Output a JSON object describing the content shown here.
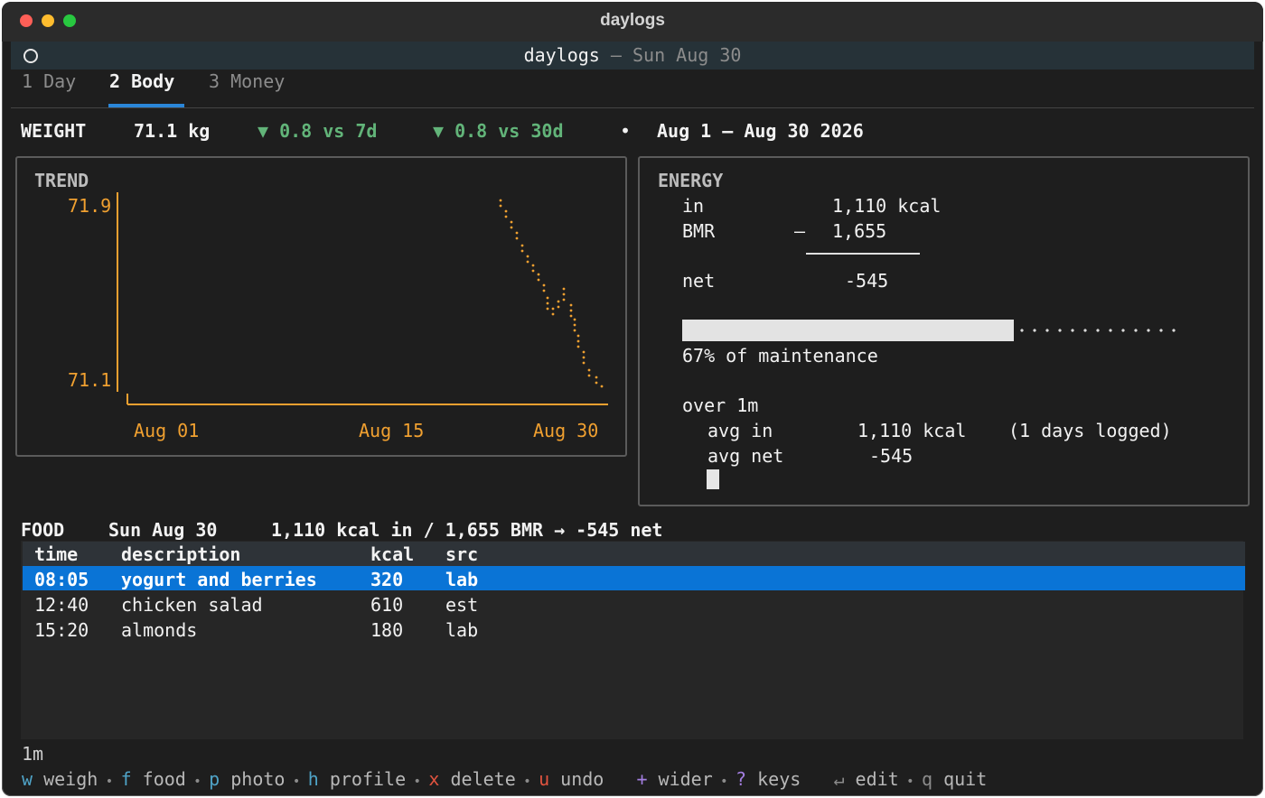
{
  "window": {
    "title": "daylogs"
  },
  "header": {
    "app": "daylogs",
    "sep": "—",
    "date": "Sun Aug 30"
  },
  "tabs": [
    {
      "num": "1",
      "label": "Day"
    },
    {
      "num": "2",
      "label": "Body"
    },
    {
      "num": "3",
      "label": "Money"
    }
  ],
  "weight_line": {
    "label": "WEIGHT",
    "value": "71.1 kg",
    "delta7": "▼ 0.8 vs 7d",
    "delta30": "▼ 0.8 vs 30d",
    "bullet": "•",
    "range": "Aug 1 — Aug 30 2026"
  },
  "trend": {
    "title": "TREND",
    "ymax_label": "71.9",
    "ymin_label": "71.1",
    "x_labels": [
      "Aug 01",
      "Aug 15",
      "Aug 30"
    ]
  },
  "energy": {
    "title": "ENERGY",
    "in_label": "in",
    "in_value": "1,110 kcal",
    "bmr_label": "BMR",
    "bmr_op": "–",
    "bmr_value": "1,655",
    "net_label": "net",
    "net_value": "-545",
    "bar_fraction": 0.67,
    "bar_caption": "67% of maintenance",
    "over_label": "over 1m",
    "avg_in_label": "avg in",
    "avg_in_value": "1,110 kcal",
    "avg_in_note": "(1 days logged)",
    "avg_net_label": "avg net",
    "avg_net_value": "-545"
  },
  "food": {
    "label": "FOOD",
    "date": "Sun Aug 30",
    "summary": "1,110 kcal in / 1,655 BMR → -545 net",
    "columns": [
      "time",
      "description",
      "kcal",
      "src"
    ],
    "rows": [
      {
        "time": "08:05",
        "description": "yogurt and berries",
        "kcal": "320",
        "src": "lab"
      },
      {
        "time": "12:40",
        "description": "chicken salad",
        "kcal": "610",
        "src": "est"
      },
      {
        "time": "15:20",
        "description": "almonds",
        "kcal": "180",
        "src": "lab"
      }
    ]
  },
  "footer": {
    "period": "1m",
    "keys": [
      {
        "key": "w",
        "label": "weigh",
        "color": "#4fa3c7"
      },
      {
        "key": "f",
        "label": "food",
        "color": "#4fa3c7"
      },
      {
        "key": "p",
        "label": "photo",
        "color": "#4fa3c7"
      },
      {
        "key": "h",
        "label": "profile",
        "color": "#4fa3c7"
      },
      {
        "key": "x",
        "label": "delete",
        "color": "#e0533f"
      },
      {
        "key": "u",
        "label": "undo",
        "color": "#e0533f"
      },
      {
        "key": "+",
        "label": "wider",
        "color": "#a37ee0"
      },
      {
        "key": "?",
        "label": "keys",
        "color": "#a37ee0"
      },
      {
        "key": "↵",
        "label": "edit",
        "color": "#8c8c8c"
      },
      {
        "key": "q",
        "label": "quit",
        "color": "#8c8c8c"
      }
    ],
    "sep": "•"
  },
  "colors": {
    "accent": "#0a74d6",
    "orange": "#f0a030",
    "green": "#62b479"
  }
}
